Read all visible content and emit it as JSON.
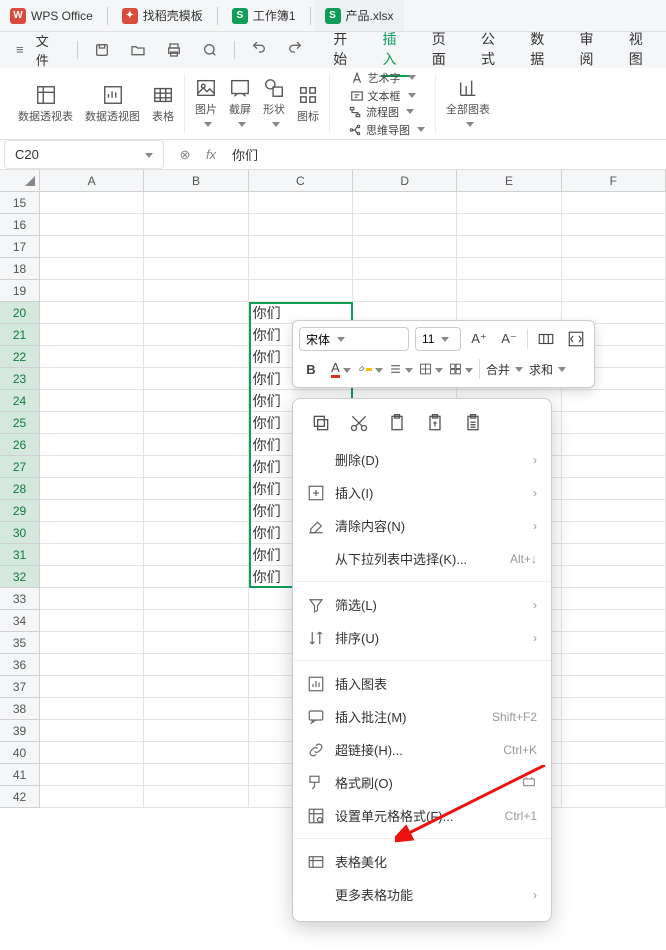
{
  "titlebar": {
    "tabs": [
      {
        "icon": "W",
        "color": "bg-red",
        "label": "WPS Office"
      },
      {
        "icon": "",
        "color": "bg-red",
        "label": "找稻壳模板"
      },
      {
        "icon": "S",
        "color": "bg-green",
        "label": "工作簿1"
      },
      {
        "icon": "S",
        "color": "bg-green",
        "label": "产品.xlsx"
      }
    ]
  },
  "quickbar": {
    "file": "文件",
    "menu": [
      "开始",
      "插入",
      "页面",
      "公式",
      "数据",
      "审阅",
      "视图"
    ],
    "active_index": 1
  },
  "ribbon": {
    "g1": [
      {
        "label": "数据透视表"
      },
      {
        "label": "数据透视图"
      },
      {
        "label": "表格"
      }
    ],
    "g2": [
      {
        "label": "图片"
      },
      {
        "label": "截屏"
      },
      {
        "label": "形状"
      },
      {
        "label": "图标"
      }
    ],
    "g3": [
      {
        "label": "艺术字"
      },
      {
        "label": "文本框"
      },
      {
        "label": "流程图"
      },
      {
        "label": "思维导图"
      }
    ],
    "g4": {
      "label": "全部图表"
    }
  },
  "formula": {
    "namebox": "C20",
    "fx": "fx",
    "value": "你们"
  },
  "grid": {
    "cols": [
      "A",
      "B",
      "C",
      "D",
      "E",
      "F"
    ],
    "rows": [
      15,
      16,
      17,
      18,
      19,
      20,
      21,
      22,
      23,
      24,
      25,
      26,
      27,
      28,
      29,
      30,
      31,
      32,
      33,
      34,
      35,
      36,
      37,
      38,
      39,
      40,
      41,
      42
    ],
    "filled_start": 20,
    "filled_end": 32,
    "filled_col": "C",
    "cell_text": "你们"
  },
  "mini": {
    "font": "宋体",
    "size": "11",
    "merge": "合并",
    "sum": "求和"
  },
  "ctx": {
    "items": [
      {
        "type": "iconrow"
      },
      {
        "icon": "",
        "label": "删除(D)",
        "chev": true
      },
      {
        "icon": "plus-grid",
        "label": "插入(I)",
        "chev": true
      },
      {
        "icon": "eraser",
        "label": "清除内容(N)",
        "chev": true
      },
      {
        "icon": "",
        "label": "从下拉列表中选择(K)...",
        "shortcut": "Alt+↓"
      },
      {
        "type": "sep"
      },
      {
        "icon": "filter",
        "label": "筛选(L)",
        "chev": true
      },
      {
        "icon": "sort",
        "label": "排序(U)",
        "chev": true
      },
      {
        "type": "sep"
      },
      {
        "icon": "chart",
        "label": "插入图表"
      },
      {
        "icon": "comment",
        "label": "插入批注(M)",
        "shortcut": "Shift+F2"
      },
      {
        "icon": "link",
        "label": "超链接(H)...",
        "shortcut": "Ctrl+K"
      },
      {
        "icon": "brush",
        "label": "格式刷(O)",
        "extra": true
      },
      {
        "icon": "format",
        "label": "设置单元格格式(F)...",
        "shortcut": "Ctrl+1"
      },
      {
        "type": "sep"
      },
      {
        "icon": "beauty",
        "label": "表格美化"
      },
      {
        "icon": "",
        "label": "更多表格功能",
        "chev": true
      }
    ]
  }
}
